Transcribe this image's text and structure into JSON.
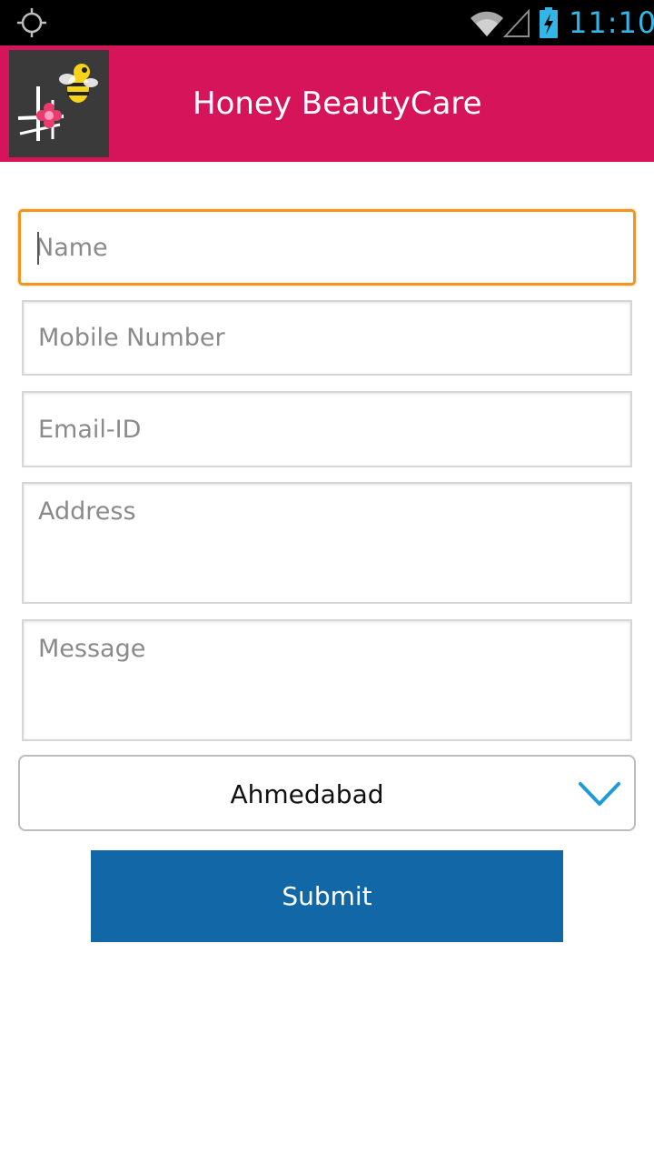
{
  "status_bar": {
    "time": "11:10",
    "icons": [
      "gps-icon",
      "wifi-icon",
      "signal-icon",
      "battery-charging-icon"
    ],
    "clock_color": "#33b5e5"
  },
  "header": {
    "title": "Honey BeautyCare",
    "background_color": "#d6145a",
    "logo": "bee-flower-logo"
  },
  "form": {
    "name": {
      "placeholder": "Name",
      "value": ""
    },
    "mobile": {
      "placeholder": "Mobile Number",
      "value": ""
    },
    "email": {
      "placeholder": "Email-ID",
      "value": ""
    },
    "address": {
      "placeholder": "Address",
      "value": ""
    },
    "message": {
      "placeholder": "Message",
      "value": ""
    },
    "city": {
      "selected": "Ahmedabad"
    },
    "submit_label": "Submit",
    "focus_color": "#f0961e",
    "submit_color": "#1268a7"
  }
}
